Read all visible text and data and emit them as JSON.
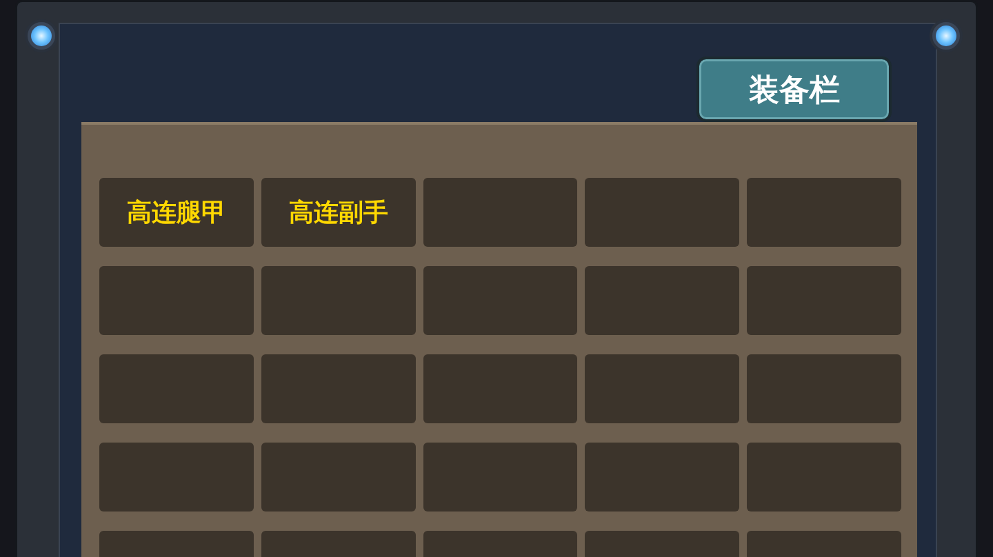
{
  "header": {
    "button": "装备栏"
  },
  "slots": [
    {
      "kind": "item",
      "label": "高连腿甲"
    },
    {
      "kind": "item",
      "label": "高连副手"
    },
    {
      "kind": "empty"
    },
    {
      "kind": "empty"
    },
    {
      "kind": "empty"
    },
    {
      "kind": "empty"
    },
    {
      "kind": "empty"
    },
    {
      "kind": "empty"
    },
    {
      "kind": "empty"
    },
    {
      "kind": "empty"
    },
    {
      "kind": "empty"
    },
    {
      "kind": "empty"
    },
    {
      "kind": "empty"
    },
    {
      "kind": "empty"
    },
    {
      "kind": "empty"
    },
    {
      "kind": "empty"
    },
    {
      "kind": "empty"
    },
    {
      "kind": "empty"
    },
    {
      "kind": "empty"
    },
    {
      "kind": "empty"
    },
    {
      "kind": "empty"
    },
    {
      "kind": "empty"
    },
    {
      "kind": "empty"
    },
    {
      "kind": "empty"
    },
    {
      "kind": "empty"
    }
  ]
}
